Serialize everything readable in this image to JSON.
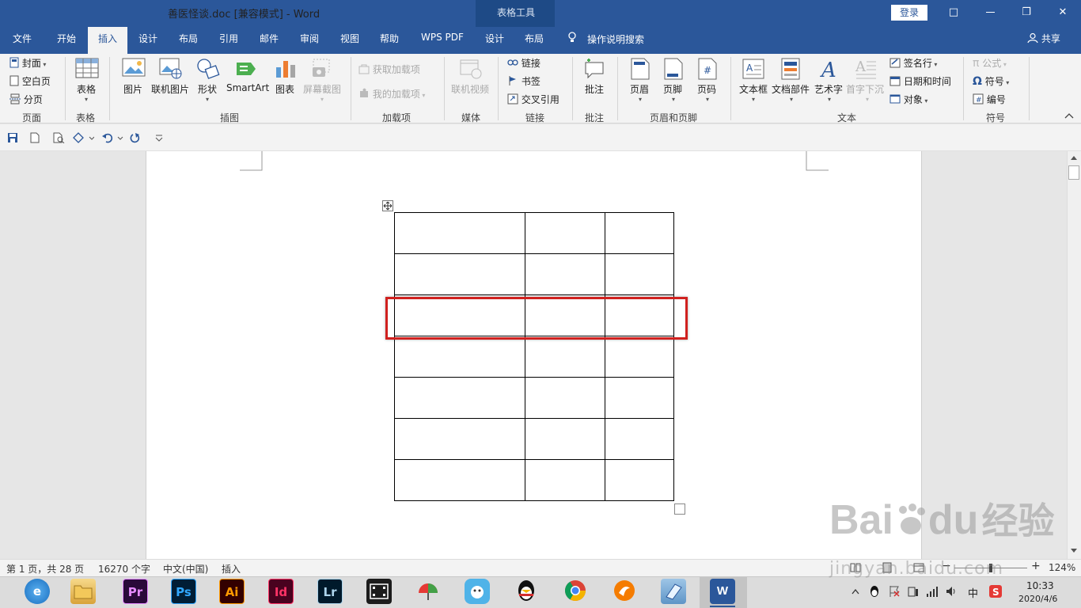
{
  "window": {
    "title": "善医怪谈.doc [兼容模式]  -  Word",
    "table_tools": "表格工具",
    "login": "登录",
    "controls": {
      "ribbon_display": "□",
      "restore": "❐",
      "close": "✕"
    }
  },
  "tabs": {
    "file": "文件",
    "home": "开始",
    "insert": "插入",
    "design": "设计",
    "layout": "布局",
    "references": "引用",
    "mailings": "邮件",
    "review": "审阅",
    "view": "视图",
    "help": "帮助",
    "wps_pdf": "WPS PDF",
    "table_design": "设计",
    "table_layout": "布局",
    "tell_me": "操作说明搜索",
    "share": "共享"
  },
  "ribbon": {
    "pages": {
      "cover": "封面",
      "blank": "空白页",
      "break": "分页",
      "group": "页面"
    },
    "tables": {
      "table": "表格",
      "group": "表格"
    },
    "illustrations": {
      "pictures": "图片",
      "online_pictures": "联机图片",
      "shapes": "形状",
      "smartart": "SmartArt",
      "chart": "图表",
      "screenshot": "屏幕截图",
      "group": "插图"
    },
    "addins": {
      "get": "获取加载项",
      "mine": "我的加载项",
      "group": "加载项"
    },
    "media": {
      "online_video": "联机视频",
      "group": "媒体"
    },
    "links": {
      "link": "链接",
      "bookmark": "书签",
      "cross_ref": "交叉引用",
      "group": "链接"
    },
    "comments": {
      "comment": "批注",
      "group": "批注"
    },
    "header_footer": {
      "header": "页眉",
      "footer": "页脚",
      "page_number": "页码",
      "group": "页眉和页脚"
    },
    "text": {
      "text_box": "文本框",
      "quick_parts": "文档部件",
      "wordart": "艺术字",
      "drop_cap": "首字下沉",
      "signature": "签名行",
      "date_time": "日期和时间",
      "object": "对象",
      "group": "文本"
    },
    "symbols": {
      "equation": "公式",
      "symbol": "符号",
      "number": "编号",
      "group": "符号"
    }
  },
  "status": {
    "page": "第 1 页，共 28 页",
    "words": "16270 个字",
    "language": "中文(中国)",
    "mode": "插入",
    "zoom": "124%",
    "zoom_minus": "−",
    "zoom_plus": "+"
  },
  "taskbar": {
    "apps": [
      {
        "name": "browser",
        "label": "e"
      },
      {
        "name": "file-explorer",
        "label": ""
      },
      {
        "name": "premiere",
        "label": "Pr"
      },
      {
        "name": "photoshop",
        "label": "Ps"
      },
      {
        "name": "illustrator",
        "label": "Ai"
      },
      {
        "name": "indesign",
        "label": "Id"
      },
      {
        "name": "lightroom",
        "label": "Lr"
      },
      {
        "name": "video-editor",
        "label": ""
      },
      {
        "name": "app-umbrella",
        "label": ""
      },
      {
        "name": "app-bird",
        "label": ""
      },
      {
        "name": "qq",
        "label": ""
      },
      {
        "name": "chrome",
        "label": ""
      },
      {
        "name": "app-orange",
        "label": ""
      },
      {
        "name": "app-note",
        "label": ""
      },
      {
        "name": "word",
        "label": "W"
      }
    ],
    "ime": "中",
    "time": "10:33",
    "date": "2020/4/6"
  },
  "watermark": {
    "brand": "Bai",
    "brand2": "du",
    "cn": "经验",
    "url": "jingyan.baidu.com"
  },
  "colors": {
    "accent": "#2b579a",
    "highlight": "#d0211f"
  }
}
